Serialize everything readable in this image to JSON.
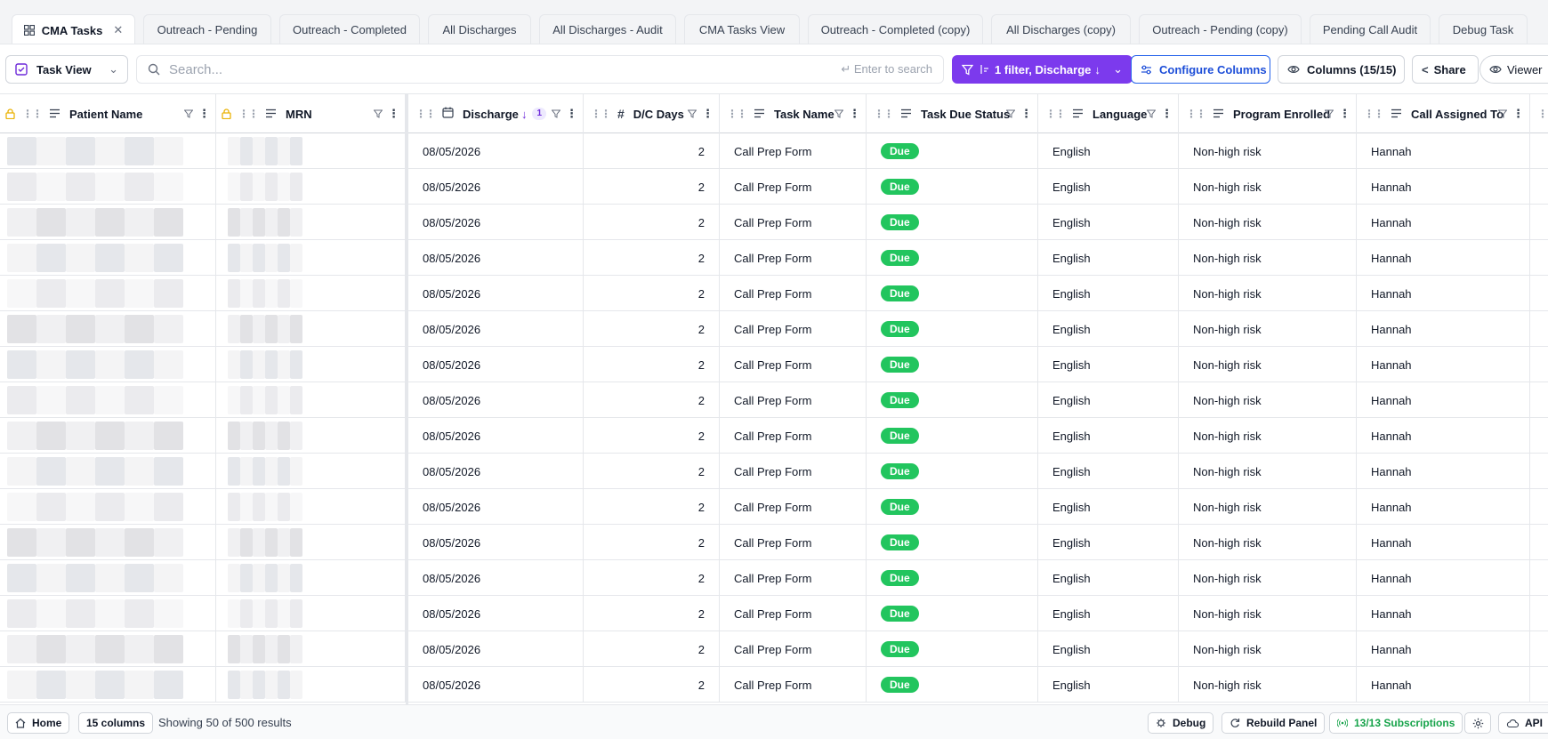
{
  "tabs": [
    {
      "label": "CMA Tasks",
      "active": true,
      "closable": true
    },
    {
      "label": "Outreach - Pending"
    },
    {
      "label": "Outreach - Completed"
    },
    {
      "label": "All Discharges"
    },
    {
      "label": "All Discharges - Audit"
    },
    {
      "label": "CMA Tasks View"
    },
    {
      "label": "Outreach - Completed (copy)"
    },
    {
      "label": "All Discharges (copy)"
    },
    {
      "label": "Outreach - Pending (copy)"
    },
    {
      "label": "Pending Call Audit"
    },
    {
      "label": "Debug Task"
    }
  ],
  "toolbar": {
    "view_label": "Task View",
    "search_placeholder": "Search...",
    "search_hint": "Enter to search",
    "filter_label": "1 filter, Discharge",
    "configure_label": "Configure Columns",
    "columns_label": "Columns (15/15)",
    "share_label": "Share",
    "viewer_label": "Viewer"
  },
  "columns": [
    {
      "label": "Patient Name",
      "icon": "text-icon",
      "locked": true
    },
    {
      "label": "MRN",
      "icon": "text-icon",
      "locked": true
    },
    {
      "label": "Discharge",
      "icon": "calendar-icon",
      "sort": "desc",
      "sort_index": "1"
    },
    {
      "label": "D/C Days",
      "icon": "hash-icon"
    },
    {
      "label": "Task Name",
      "icon": "text-icon"
    },
    {
      "label": "Task Due Status",
      "icon": "text-icon"
    },
    {
      "label": "Language",
      "icon": "text-icon"
    },
    {
      "label": "Program Enrolled",
      "icon": "text-icon"
    },
    {
      "label": "Call Assigned To",
      "icon": "text-icon"
    }
  ],
  "rows": [
    {
      "discharge": "08/05/2026",
      "dc_days": "2",
      "task_name": "Call Prep Form",
      "status": "Due",
      "language": "English",
      "program": "Non-high risk",
      "assigned": "Hannah"
    },
    {
      "discharge": "08/05/2026",
      "dc_days": "2",
      "task_name": "Call Prep Form",
      "status": "Due",
      "language": "English",
      "program": "Non-high risk",
      "assigned": "Hannah"
    },
    {
      "discharge": "08/05/2026",
      "dc_days": "2",
      "task_name": "Call Prep Form",
      "status": "Due",
      "language": "English",
      "program": "Non-high risk",
      "assigned": "Hannah"
    },
    {
      "discharge": "08/05/2026",
      "dc_days": "2",
      "task_name": "Call Prep Form",
      "status": "Due",
      "language": "English",
      "program": "Non-high risk",
      "assigned": "Hannah"
    },
    {
      "discharge": "08/05/2026",
      "dc_days": "2",
      "task_name": "Call Prep Form",
      "status": "Due",
      "language": "English",
      "program": "Non-high risk",
      "assigned": "Hannah"
    },
    {
      "discharge": "08/05/2026",
      "dc_days": "2",
      "task_name": "Call Prep Form",
      "status": "Due",
      "language": "English",
      "program": "Non-high risk",
      "assigned": "Hannah"
    },
    {
      "discharge": "08/05/2026",
      "dc_days": "2",
      "task_name": "Call Prep Form",
      "status": "Due",
      "language": "English",
      "program": "Non-high risk",
      "assigned": "Hannah"
    },
    {
      "discharge": "08/05/2026",
      "dc_days": "2",
      "task_name": "Call Prep Form",
      "status": "Due",
      "language": "English",
      "program": "Non-high risk",
      "assigned": "Hannah"
    },
    {
      "discharge": "08/05/2026",
      "dc_days": "2",
      "task_name": "Call Prep Form",
      "status": "Due",
      "language": "English",
      "program": "Non-high risk",
      "assigned": "Hannah"
    },
    {
      "discharge": "08/05/2026",
      "dc_days": "2",
      "task_name": "Call Prep Form",
      "status": "Due",
      "language": "English",
      "program": "Non-high risk",
      "assigned": "Hannah"
    },
    {
      "discharge": "08/05/2026",
      "dc_days": "2",
      "task_name": "Call Prep Form",
      "status": "Due",
      "language": "English",
      "program": "Non-high risk",
      "assigned": "Hannah"
    },
    {
      "discharge": "08/05/2026",
      "dc_days": "2",
      "task_name": "Call Prep Form",
      "status": "Due",
      "language": "English",
      "program": "Non-high risk",
      "assigned": "Hannah"
    },
    {
      "discharge": "08/05/2026",
      "dc_days": "2",
      "task_name": "Call Prep Form",
      "status": "Due",
      "language": "English",
      "program": "Non-high risk",
      "assigned": "Hannah"
    },
    {
      "discharge": "08/05/2026",
      "dc_days": "2",
      "task_name": "Call Prep Form",
      "status": "Due",
      "language": "English",
      "program": "Non-high risk",
      "assigned": "Hannah"
    },
    {
      "discharge": "08/05/2026",
      "dc_days": "2",
      "task_name": "Call Prep Form",
      "status": "Due",
      "language": "English",
      "program": "Non-high risk",
      "assigned": "Hannah"
    },
    {
      "discharge": "08/05/2026",
      "dc_days": "2",
      "task_name": "Call Prep Form",
      "status": "Due",
      "language": "English",
      "program": "Non-high risk",
      "assigned": "Hannah"
    }
  ],
  "footer": {
    "home_label": "Home",
    "columns_count": "15 columns",
    "results_text": "Showing 50 of 500 results",
    "debug_label": "Debug",
    "rebuild_label": "Rebuild Panel",
    "subscriptions_label": "13/13 Subscriptions",
    "api_label": "API"
  },
  "colors": {
    "accent_purple": "#7c3aed",
    "accent_blue": "#2563eb",
    "status_due": "#22c55e",
    "subscriptions_green": "#16a34a"
  }
}
